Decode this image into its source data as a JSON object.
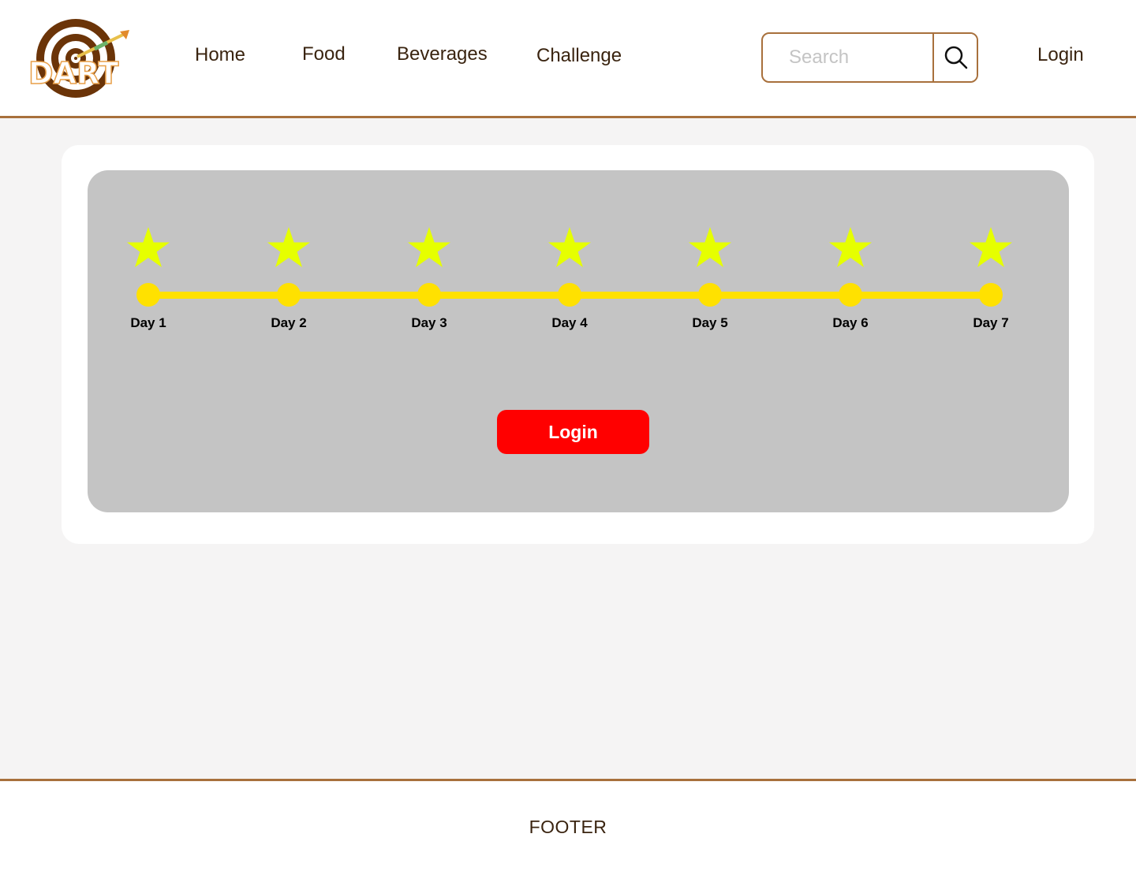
{
  "header": {
    "logo_text": "DART",
    "nav": [
      {
        "label": "Home"
      },
      {
        "label": "Food"
      },
      {
        "label": "Beverages"
      },
      {
        "label": "Challenge"
      }
    ],
    "search": {
      "placeholder": "Search",
      "value": "",
      "icon": "search-icon"
    },
    "login_label": "Login"
  },
  "challenge": {
    "days": [
      {
        "label": "Day 1",
        "icon": "star-icon"
      },
      {
        "label": "Day 2",
        "icon": "star-icon"
      },
      {
        "label": "Day 3",
        "icon": "star-icon"
      },
      {
        "label": "Day 4",
        "icon": "star-icon"
      },
      {
        "label": "Day 5",
        "icon": "star-icon"
      },
      {
        "label": "Day 6",
        "icon": "star-icon"
      },
      {
        "label": "Day 7",
        "icon": "star-icon"
      }
    ],
    "login_button_label": "Login",
    "colors": {
      "star": "#e6ff00",
      "track": "#ffe100",
      "button": "#ff0000",
      "panel": "#c4c4c4",
      "accent": "#a8703c"
    }
  },
  "footer": {
    "text": "FOOTER"
  }
}
